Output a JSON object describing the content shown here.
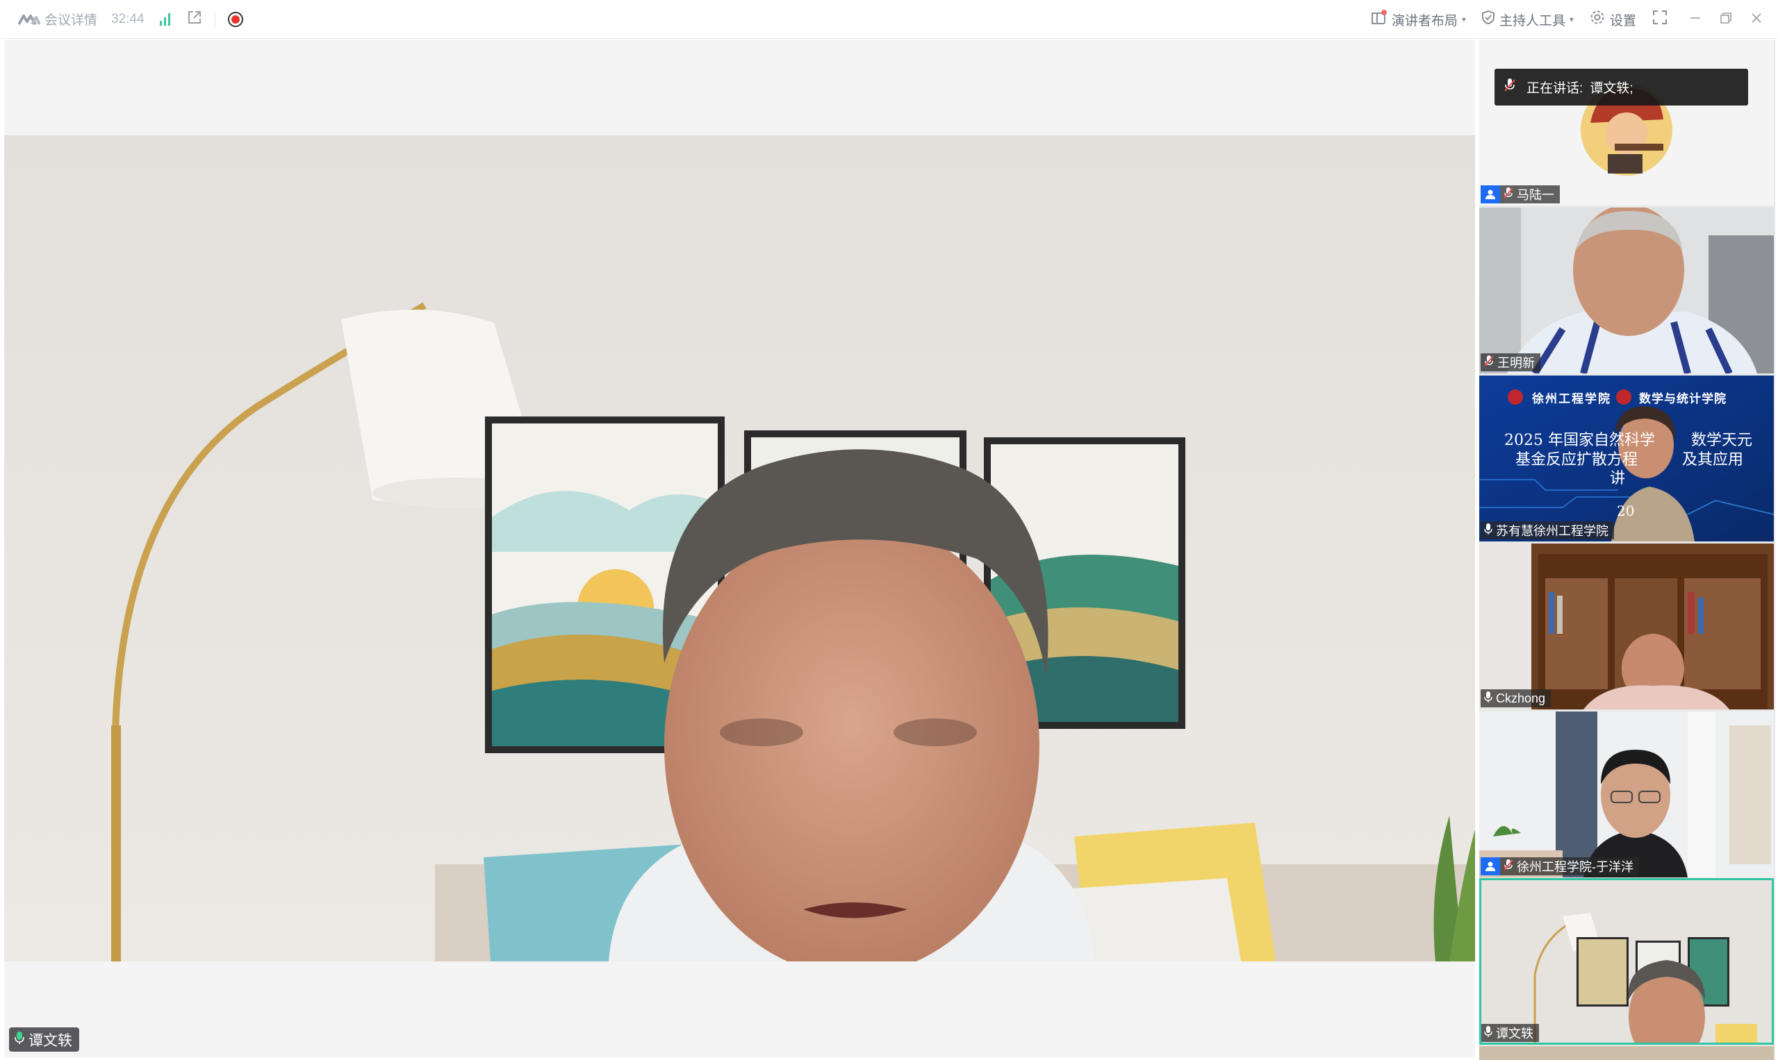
{
  "toolbar": {
    "meeting_details": "会议详情",
    "duration": "32:44",
    "presenter_layout": "演讲者布局",
    "host_tools": "主持人工具",
    "settings": "设置"
  },
  "speaking_banner": {
    "label": "正在讲话:",
    "speaker": "谭文轶;"
  },
  "main_video": {
    "participant_name": "谭文轶"
  },
  "gallery": {
    "tiles": [
      {
        "name": "马陆一"
      },
      {
        "name": "王明新"
      },
      {
        "name": "苏有慧徐州工程学院"
      },
      {
        "name": "Ckzhong"
      },
      {
        "name": "徐州工程学院-于洋洋"
      },
      {
        "name": "谭文轶"
      }
    ]
  },
  "slide": {
    "school": "徐州工程学院",
    "college": "数学与统计学院",
    "line1": "2025 年国家自然科学",
    "line1b": "数学天元",
    "line2": "基金反应扩散方程",
    "line2b": "及其应用",
    "line3": "讲",
    "line4": "20"
  },
  "colors": {
    "accent_green": "#2fc5a3",
    "record_red": "#e8342f",
    "host_badge_blue": "#1e6cf5"
  },
  "icons": [
    "logo-icon",
    "signal-icon",
    "external-link-icon",
    "record-icon",
    "layout-icon",
    "shield-icon",
    "gear-icon",
    "fullscreen-icon",
    "minimize-icon",
    "restore-icon",
    "close-icon",
    "mic-muted-icon",
    "mic-icon",
    "person-icon"
  ]
}
